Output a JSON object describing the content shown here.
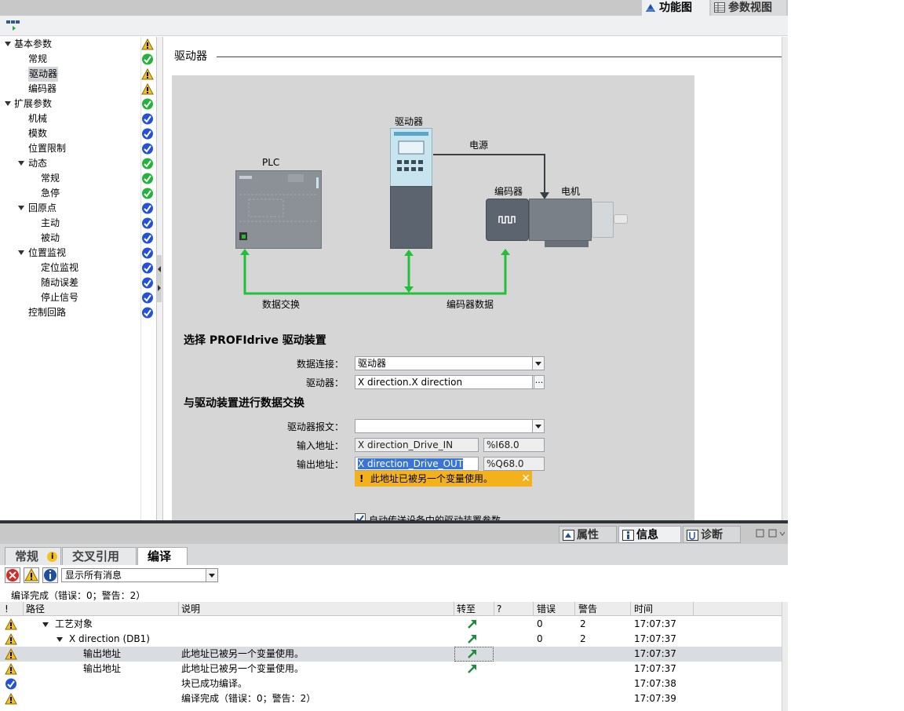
{
  "view_tabs": {
    "functional": "功能图",
    "parameter": "参数视图"
  },
  "nav": {
    "items": [
      {
        "label": "基本参数",
        "status": "warning"
      },
      {
        "label": "常规",
        "status": "ok"
      },
      {
        "label": "驱动器",
        "status": "warning"
      },
      {
        "label": "编码器",
        "status": "warning"
      },
      {
        "label": "扩展参数",
        "status": "ok"
      },
      {
        "label": "机械",
        "status": "done"
      },
      {
        "label": "模数",
        "status": "done"
      },
      {
        "label": "位置限制",
        "status": "done"
      },
      {
        "label": "动态",
        "status": "ok"
      },
      {
        "label": "常规",
        "status": "ok"
      },
      {
        "label": "急停",
        "status": "ok"
      },
      {
        "label": "回原点",
        "status": "done"
      },
      {
        "label": "主动",
        "status": "done"
      },
      {
        "label": "被动",
        "status": "done"
      },
      {
        "label": "位置监视",
        "status": "done"
      },
      {
        "label": "定位监视",
        "status": "done"
      },
      {
        "label": "随动误差",
        "status": "done"
      },
      {
        "label": "停止信号",
        "status": "done"
      },
      {
        "label": "控制回路",
        "status": "done"
      }
    ]
  },
  "main": {
    "section_title": "驱动器",
    "diagram": {
      "plc": "PLC",
      "drive": "驱动器",
      "power": "电源",
      "encoder": "编码器",
      "motor": "电机",
      "data_exchange": "数据交换",
      "encoder_data": "编码器数据"
    },
    "select_heading": "选择 PROFIdrive 驱动装置",
    "data_connection_label": "数据连接：",
    "data_connection_value": "驱动器",
    "drive_label": "驱动器：",
    "drive_value": "X direction.X  direction",
    "browse": "...",
    "exchange_heading": "与驱动装置进行数据交换",
    "telegram_label": "驱动器报文：",
    "telegram_value": "",
    "input_label": "输入地址：",
    "input_value": "X direction_Drive_IN",
    "input_address": "%I68.0",
    "output_label": "输出地址：",
    "output_value": "X direction_Drive_OUT",
    "output_address": "%Q68.0",
    "warning_tip": "此地址已被另一个变量使用。",
    "warning_bang": "!",
    "warning_close": "✕",
    "auto_transfer": "自动传送设备中的驱动装置参数"
  },
  "inspector": {
    "tabs": {
      "properties": "属性",
      "info": "信息",
      "diagnostics": "诊断"
    },
    "subtabs": {
      "general": "常规",
      "xref": "交叉引用",
      "compile": "编译"
    },
    "filter_value": "显示所有消息",
    "summary": "编译完成（错误：0；警告：2）",
    "columns": {
      "bang": "!",
      "path": "路径",
      "desc": "说明",
      "goto": "转至",
      "q": "?",
      "errors": "错误",
      "warnings": "警告",
      "time": "时间"
    },
    "rows": [
      {
        "icon": "warning",
        "path": "工艺对象",
        "desc": "",
        "goto": true,
        "errors": "0",
        "warnings": "2",
        "time": "17:07:37"
      },
      {
        "icon": "warning",
        "path": "X direction (DB1)",
        "desc": "",
        "goto": true,
        "errors": "0",
        "warnings": "2",
        "time": "17:07:37"
      },
      {
        "icon": "warning",
        "path": "输出地址",
        "desc": "此地址已被另一个变量使用。",
        "goto": true,
        "errors": "",
        "warnings": "",
        "time": "17:07:37"
      },
      {
        "icon": "warning",
        "path": "输出地址",
        "desc": "此地址已被另一个变量使用。",
        "goto": true,
        "errors": "",
        "warnings": "",
        "time": "17:07:37"
      },
      {
        "icon": "done",
        "path": "",
        "desc": "块已成功编译。",
        "goto": false,
        "errors": "",
        "warnings": "",
        "time": "17:07:38"
      },
      {
        "icon": "warning",
        "path": "",
        "desc": "编译完成（错误：0；警告：2）",
        "goto": false,
        "errors": "",
        "warnings": "",
        "time": "17:07:39"
      }
    ]
  },
  "colors": {
    "accent_green": "#22c03a",
    "warning_yellow": "#f3b21b",
    "done_blue": "#2550d8",
    "error_red": "#d62828"
  }
}
